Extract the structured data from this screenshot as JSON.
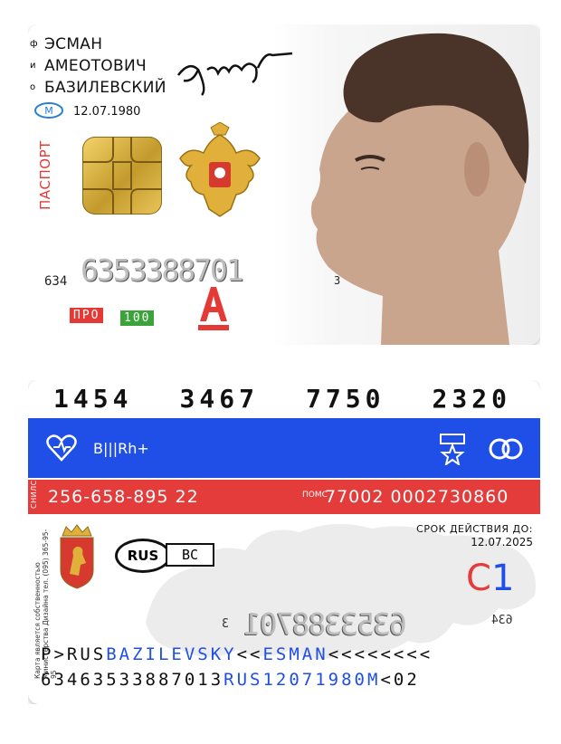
{
  "front": {
    "name_letters": [
      "ф",
      "и",
      "о"
    ],
    "surname": "ЭСМАН",
    "patronymic": "АМЕОТОВИЧ",
    "family": "БАЗИЛЕВСКИЙ",
    "dob": "12.07.1980",
    "metro_letter": "М",
    "pasport_label": "ПАСПОРТ",
    "number_prefix": "634",
    "number_main": "6353388701",
    "number_suffix": "3",
    "pro_label": "ПРО",
    "sto_label": "100",
    "alfa_letter": "А"
  },
  "back": {
    "card_number": [
      "1454",
      "3467",
      "7750",
      "2320"
    ],
    "blood_type": "B|||Rh+",
    "snils_label": "СНИЛС",
    "snils": "256-658-895 22",
    "oms_icon": "ПОМС",
    "oms": "77002 0002730860",
    "expiry_label": "СРОК ДЕЙСТВИЯ ДО:",
    "expiry_date": "12.07.2025",
    "category_letter": "C",
    "category_number": "1",
    "rus_oval": "RUS",
    "rus_bc": "BC",
    "vertical_text": "Карта является собственностью Министерства Дизайна тел. (095) 365-95-95",
    "mirror_prefix": "634",
    "mirror_main": "6353388701",
    "mirror_suffix": "3",
    "mrz1": {
      "p1": "P>RUS",
      "p2": "BAZILEVSKY",
      "p3": "<<",
      "p4": "ESMAN",
      "p5": "<<<<<<<<"
    },
    "mrz2": {
      "p1": "6346353388701З",
      "p2": "RUS12071980M",
      "p3": "<02"
    }
  },
  "colors": {
    "blue": "#1f4fe6",
    "red": "#e43b3b",
    "green": "#3aa33a"
  }
}
